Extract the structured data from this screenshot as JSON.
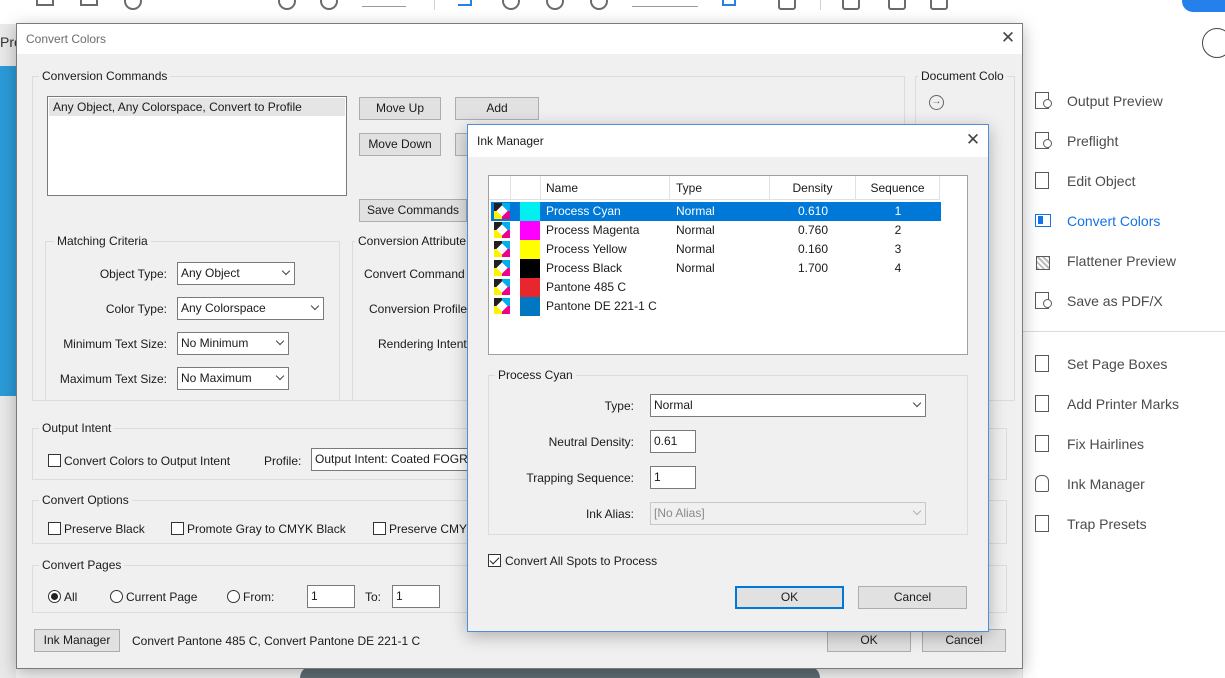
{
  "background": {
    "partial_left_text": "Pro",
    "tools_panel": {
      "items": [
        {
          "label": "Output Preview",
          "icon": "output-preview-icon",
          "active": false
        },
        {
          "label": "Preflight",
          "icon": "preflight-icon",
          "active": false
        },
        {
          "label": "Edit Object",
          "icon": "edit-object-icon",
          "active": false
        },
        {
          "label": "Convert Colors",
          "icon": "convert-colors-icon",
          "active": true
        },
        {
          "label": "Flattener Preview",
          "icon": "flattener-preview-icon",
          "active": false
        },
        {
          "label": "Save as PDF/X",
          "icon": "save-pdfx-icon",
          "active": false
        },
        {
          "label": "Set Page Boxes",
          "icon": "set-page-boxes-icon",
          "active": false
        },
        {
          "label": "Add Printer Marks",
          "icon": "add-printer-marks-icon",
          "active": false
        },
        {
          "label": "Fix Hairlines",
          "icon": "fix-hairlines-icon",
          "active": false
        },
        {
          "label": "Ink Manager",
          "icon": "ink-manager-icon",
          "active": false
        },
        {
          "label": "Trap Presets",
          "icon": "trap-presets-icon",
          "active": false
        }
      ],
      "active_color": "#1473e6"
    }
  },
  "convert_colors": {
    "title": "Convert Colors",
    "conversion_commands": {
      "group_title": "Conversion Commands",
      "list_items": [
        "Any Object, Any Colorspace, Convert to Profile"
      ],
      "move_up": "Move Up",
      "move_down": "Move Down",
      "add": "Add",
      "save_commands": "Save Commands"
    },
    "document_colors_partial": "Document Colo",
    "matching_criteria": {
      "group_title": "Matching Criteria",
      "object_type_label": "Object Type:",
      "object_type_value": "Any Object",
      "color_type_label": "Color Type:",
      "color_type_value": "Any Colorspace",
      "min_text_label": "Minimum Text Size:",
      "min_text_value": "No Minimum",
      "max_text_label": "Maximum Text Size:",
      "max_text_value": "No Maximum"
    },
    "conversion_attributes": {
      "group_title": "Conversion Attribute",
      "command_label": "Convert Command",
      "profile_label": "Conversion Profile",
      "intent_label": "Rendering Intent"
    },
    "output_intent": {
      "group_title": "Output Intent",
      "checkbox_label": "Convert Colors to Output Intent",
      "checked": false,
      "profile_label": "Profile:",
      "profile_value": "Output Intent: Coated FOGRA"
    },
    "convert_options": {
      "group_title": "Convert Options",
      "preserve_black": "Preserve Black",
      "promote_gray": "Promote Gray to CMYK Black",
      "preserve_cmyk": "Preserve CMYK"
    },
    "convert_pages": {
      "group_title": "Convert Pages",
      "all": "All",
      "current_page": "Current Page",
      "from_label": "From:",
      "from_value": "1",
      "to_label": "To:",
      "to_value": "1",
      "selected": "all"
    },
    "footer": {
      "ink_manager_button": "Ink Manager",
      "status_text": "Convert Pantone 485 C, Convert Pantone DE 221-1 C",
      "ok": "OK",
      "cancel": "Cancel"
    }
  },
  "ink_manager": {
    "title": "Ink Manager",
    "columns": [
      "Name",
      "Type",
      "Density",
      "Sequence"
    ],
    "inks": [
      {
        "name": "Process Cyan",
        "type": "Normal",
        "density": "0.610",
        "sequence": "1",
        "color": "#00f0f0",
        "selected": true
      },
      {
        "name": "Process Magenta",
        "type": "Normal",
        "density": "0.760",
        "sequence": "2",
        "color": "#ff00ff",
        "selected": false
      },
      {
        "name": "Process Yellow",
        "type": "Normal",
        "density": "0.160",
        "sequence": "3",
        "color": "#ffff00",
        "selected": false
      },
      {
        "name": "Process Black",
        "type": "Normal",
        "density": "1.700",
        "sequence": "4",
        "color": "#000000",
        "selected": false
      },
      {
        "name": "Pantone 485 C",
        "type": "",
        "density": "",
        "sequence": "",
        "color": "#e8262d",
        "selected": false
      },
      {
        "name": "Pantone DE 221-1 C",
        "type": "",
        "density": "",
        "sequence": "",
        "color": "#0077c0",
        "selected": false
      }
    ],
    "detail": {
      "group_title": "Process Cyan",
      "type_label": "Type:",
      "type_value": "Normal",
      "density_label": "Neutral Density:",
      "density_value": "0.61",
      "trapping_label": "Trapping Sequence:",
      "trapping_value": "1",
      "alias_label": "Ink Alias:",
      "alias_value": "[No Alias]"
    },
    "convert_all_spots": {
      "label": "Convert All Spots to Process",
      "checked": true
    },
    "ok": "OK",
    "cancel": "Cancel"
  }
}
